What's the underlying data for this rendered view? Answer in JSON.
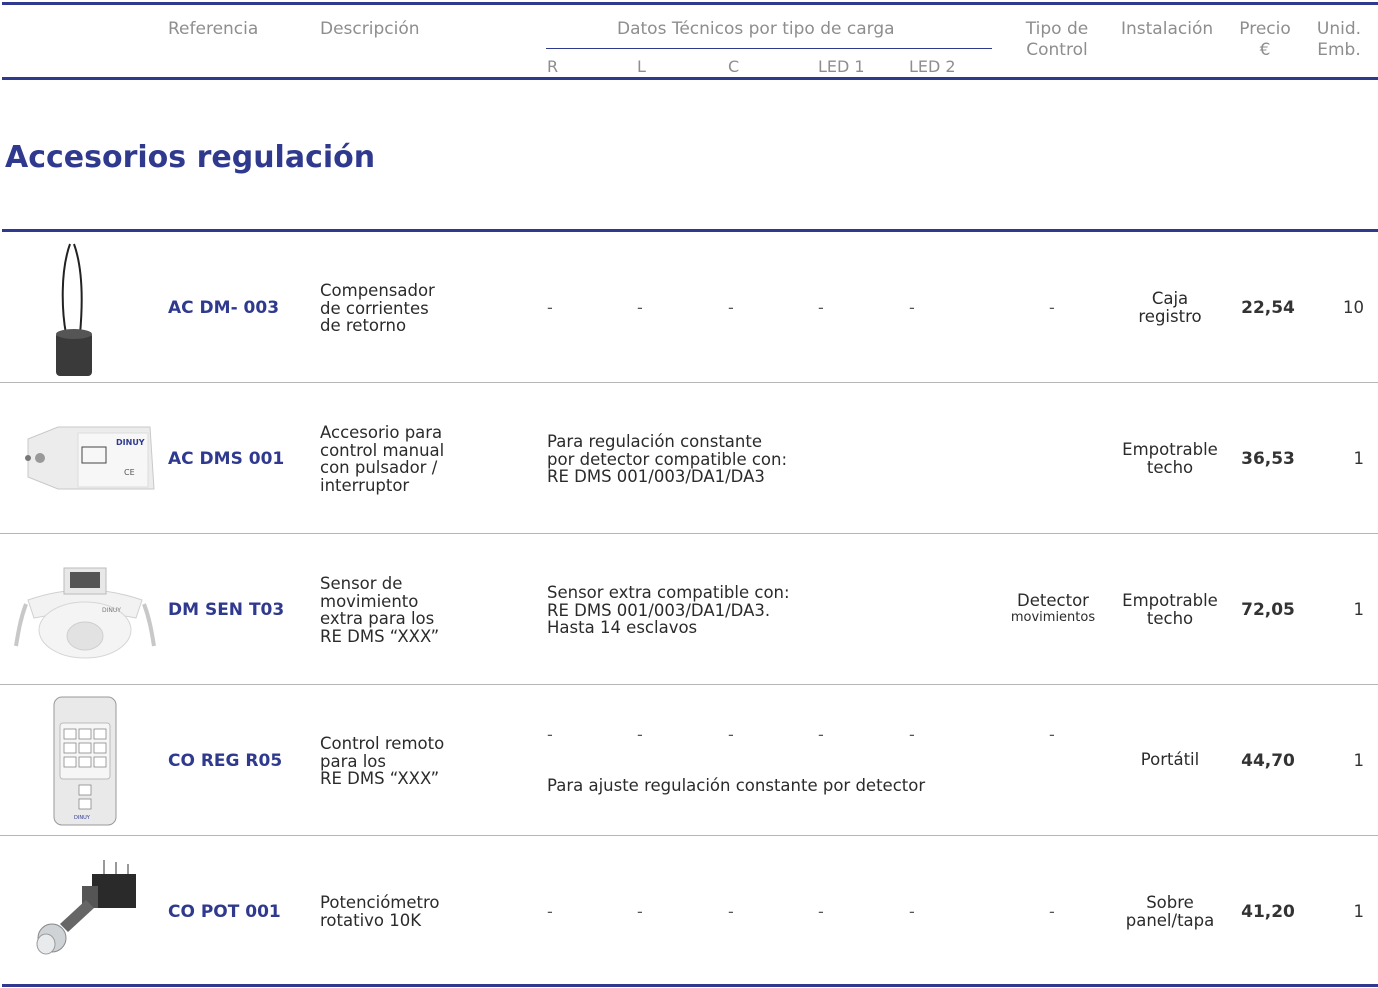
{
  "header": {
    "referencia": "Referencia",
    "descripcion": "Descripción",
    "datos_tecnicos": "Datos Técnicos por tipo de carga",
    "sub": [
      "R",
      "L",
      "C",
      "LED 1",
      "LED 2"
    ],
    "tipo_control": [
      "Tipo de",
      "Control"
    ],
    "instalacion": "Instalación",
    "precio": [
      "Precio",
      "€"
    ],
    "unid": [
      "Unid.",
      "Emb."
    ]
  },
  "section_title": "Accesorios regulación",
  "dash": "-",
  "rows": [
    {
      "ref": "AC DM- 003",
      "desc": [
        "Compensador",
        "de corrientes",
        "de retorno"
      ],
      "control": "-",
      "inst": [
        "Caja",
        "registro"
      ],
      "precio": "22,54",
      "unid": "10",
      "image_icon": "ferrite-core-icon"
    },
    {
      "ref": "AC DMS 001",
      "desc": [
        "Accesorio para",
        "control manual",
        "con pulsador /",
        "interruptor"
      ],
      "note": [
        "Para regulación constante",
        "por detector compatible con:",
        "RE DMS 001/003/DA1/DA3"
      ],
      "inst": [
        "Empotrable",
        "techo"
      ],
      "precio": "36,53",
      "unid": "1",
      "image_icon": "control-module-icon",
      "brand": "DINUY"
    },
    {
      "ref": "DM SEN T03",
      "desc": [
        "Sensor de",
        "movimiento",
        "extra para los",
        "RE DMS “XXX”"
      ],
      "note": [
        "Sensor extra compatible con:",
        "RE DMS 001/003/DA1/DA3.",
        "Hasta 14 esclavos"
      ],
      "control": [
        "Detector",
        "movimientos"
      ],
      "inst": [
        "Empotrable",
        "techo"
      ],
      "precio": "72,05",
      "unid": "1",
      "image_icon": "ceiling-sensor-icon"
    },
    {
      "ref": "CO REG R05",
      "desc": [
        "Control remoto",
        "para los",
        "RE DMS “XXX”"
      ],
      "note": "Para ajuste regulación constante por detector",
      "control": "-",
      "inst": [
        "Portátil"
      ],
      "precio": "44,70",
      "unid": "1",
      "image_icon": "remote-control-icon"
    },
    {
      "ref": "CO POT 001",
      "desc": [
        "Potenciómetro",
        "rotativo 10K"
      ],
      "control": "-",
      "inst": [
        "Sobre",
        "panel/tapa"
      ],
      "precio": "41,20",
      "unid": "1",
      "image_icon": "potentiometer-icon"
    }
  ]
}
